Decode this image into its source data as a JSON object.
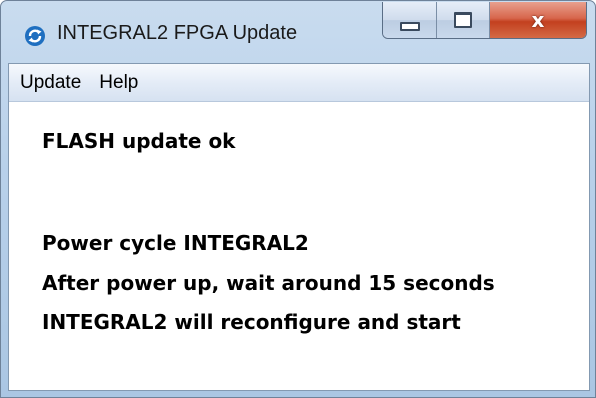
{
  "window": {
    "title": "INTEGRAL2 FPGA Update",
    "app_icon": "refresh-cycle-icon",
    "controls": {
      "minimize_icon": "minimize-icon",
      "maximize_icon": "maximize-icon",
      "close_label": "x"
    }
  },
  "menu": {
    "items": [
      {
        "label": "Update"
      },
      {
        "label": "Help"
      }
    ]
  },
  "messages": {
    "status": "FLASH update ok",
    "lines": [
      "Power cycle INTEGRAL2",
      "After power up, wait around 15 seconds",
      "INTEGRAL2 will reconfigure and start"
    ]
  },
  "colors": {
    "frame": "#b9d1ea",
    "close_button": "#c3401f",
    "menubar": "#e4ecf7",
    "icon_blue": "#1f6fc0"
  }
}
